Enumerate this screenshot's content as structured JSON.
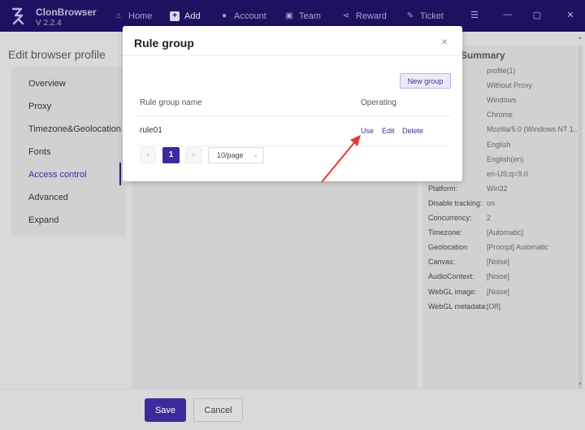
{
  "app": {
    "name": "ClonBrowser",
    "version": "V 2.2.4"
  },
  "nav": [
    {
      "label": "Home",
      "icon": "home-icon"
    },
    {
      "label": "Add",
      "icon": "plus-square-icon",
      "active": true
    },
    {
      "label": "Account",
      "icon": "user-icon"
    },
    {
      "label": "Team",
      "icon": "team-icon"
    },
    {
      "label": "Reward",
      "icon": "share-icon"
    },
    {
      "label": "Ticket",
      "icon": "ticket-icon"
    }
  ],
  "page": {
    "title": "Edit browser profile"
  },
  "sidebar": {
    "items": [
      {
        "label": "Overview"
      },
      {
        "label": "Proxy"
      },
      {
        "label": "Timezone&Geolocation"
      },
      {
        "label": "Fonts"
      },
      {
        "label": "Access control",
        "active": true
      },
      {
        "label": "Advanced"
      },
      {
        "label": "Expand"
      }
    ]
  },
  "summary": {
    "title": "Summary",
    "rows": [
      {
        "label": "",
        "value": "profile(1)"
      },
      {
        "label": "",
        "value": "Without Proxy"
      },
      {
        "label": "",
        "value": "Windows"
      },
      {
        "label": "",
        "value": "Chrome"
      },
      {
        "label": "",
        "value": "Mozilla/5.0 (Windows NT 1..."
      },
      {
        "label": "",
        "value": "English"
      },
      {
        "label": "",
        "value": "English(en)"
      },
      {
        "label": "",
        "value": "en-US;q=9.0"
      },
      {
        "label": "Platform:",
        "value": "Win32"
      },
      {
        "label": "Disable tracking:",
        "value": "on"
      },
      {
        "label": "Concurrency:",
        "value": "2"
      },
      {
        "label": "Timezone:",
        "value": "[Automatic]"
      },
      {
        "label": "Geolocation",
        "value": "[Prompt] Automatic"
      },
      {
        "label": "Canvas:",
        "value": "[Noise]"
      },
      {
        "label": "AudioContext:",
        "value": "[Noise]"
      },
      {
        "label": "WebGL image:",
        "value": "[Noise]"
      },
      {
        "label": "WebGL metadata:",
        "value": "[Off]"
      }
    ]
  },
  "footer": {
    "save_label": "Save",
    "cancel_label": "Cancel"
  },
  "modal": {
    "title": "Rule group",
    "close_glyph": "×",
    "new_group_label": "New group",
    "columns": {
      "name": "Rule group name",
      "operating": "Operating"
    },
    "rows": [
      {
        "name": "rule01",
        "actions": {
          "use": "Use",
          "edit": "Edit",
          "delete": "Delete"
        }
      }
    ],
    "pagination": {
      "prev": "‹",
      "current": "1",
      "next": "›",
      "page_size": "10/page"
    }
  },
  "colors": {
    "accent": "#3d2a9c",
    "topbar": "#1c1260",
    "arrow": "#e53935"
  }
}
